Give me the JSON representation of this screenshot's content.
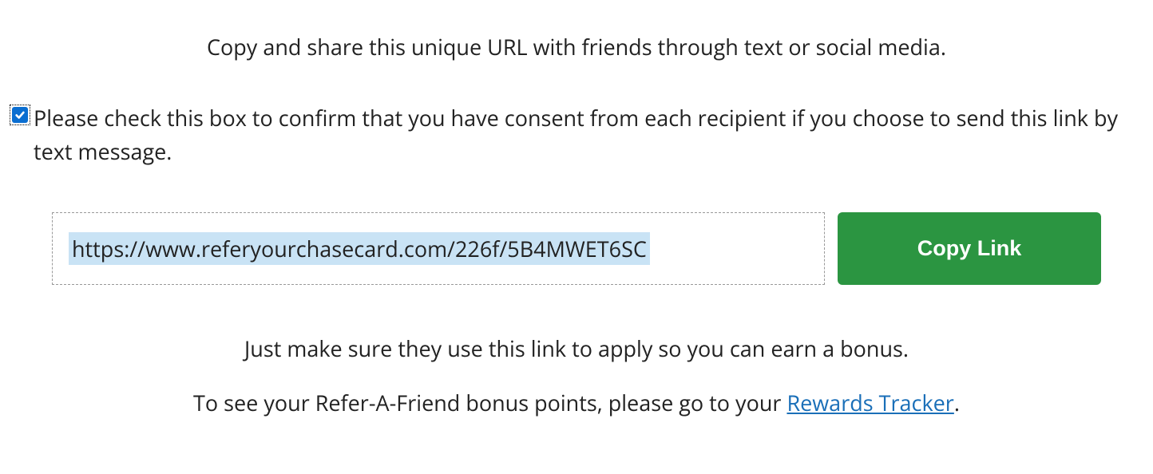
{
  "heading": "Copy and share this unique URL with friends through text or social media.",
  "consent": {
    "checked": true,
    "label": "Please check this box to confirm that you have consent from each recipient if you choose to send this link by text message."
  },
  "url_box": {
    "value": "https://www.referyourchasecard.com/226f/5B4MWET6SC"
  },
  "copy_button_label": "Copy Link",
  "footer_line1": "Just make sure they use this link to apply so you can earn a bonus.",
  "footer_line2_prefix": "To see your Refer-A-Friend bonus points, please go to your ",
  "footer_link_text": "Rewards Tracker",
  "footer_line2_suffix": "."
}
